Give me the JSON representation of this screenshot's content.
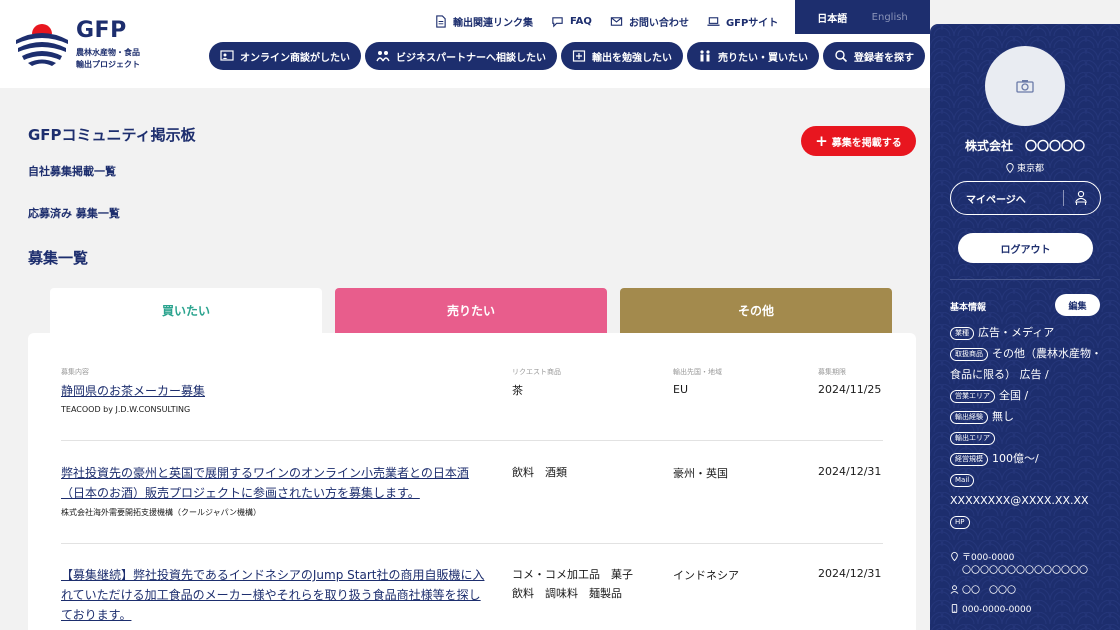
{
  "header": {
    "logo_text": "GFP",
    "logo_sub1": "農林水産物・食品",
    "logo_sub2": "輸出プロジェクト",
    "util_links": [
      {
        "label": "輸出関連リンク集",
        "icon": "document-icon"
      },
      {
        "label": "FAQ",
        "icon": "chat-icon"
      },
      {
        "label": "お問い合わせ",
        "icon": "mail-icon"
      },
      {
        "label": "GFPサイト",
        "icon": "laptop-icon"
      }
    ],
    "lang": {
      "ja": "日本語",
      "en": "English"
    },
    "nav": [
      {
        "label": "オンライン商談がしたい",
        "icon": "online-meeting-icon"
      },
      {
        "label": "ビジネスパートナーへ相談したい",
        "icon": "partner-icon"
      },
      {
        "label": "輸出を勉強したい",
        "icon": "study-icon"
      },
      {
        "label": "売りたい・買いたい",
        "icon": "trade-icon"
      },
      {
        "label": "登録者を探す",
        "icon": "search-icon"
      }
    ]
  },
  "main": {
    "title": "GFPコミュニティ掲示板",
    "post_button": "募集を掲載する",
    "link_own": "自社募集掲載一覧",
    "link_applied": "応募済み 募集一覧",
    "section_title": "募集一覧",
    "tabs": [
      "買いたい",
      "売りたい",
      "その他"
    ],
    "columns": [
      "募集内容",
      "リクエスト商品",
      "輸出先国・地域",
      "募集期限"
    ],
    "rows": [
      {
        "title": "静岡県のお茶メーカー募集",
        "org": "TEACOOD by J.D.W.CONSULTING",
        "product": "茶",
        "dest": "EU",
        "date": "2024/11/25"
      },
      {
        "title": "弊社投資先の豪州と英国で展開するワインのオンライン小売業者との日本酒（日本のお酒）販売プロジェクトに参画されたい方を募集します。",
        "org": "株式会社海外需要開拓支援機構（クールジャパン機構）",
        "product": "飲料　酒類",
        "dest": "豪州・英国",
        "date": "2024/12/31"
      },
      {
        "title": "【募集継続】弊社投資先であるインドネシアのJump Start社の商用自販機に入れていただける加工食品のメーカー様やそれらを取り扱う食品商社様等を探しております。",
        "org": "",
        "product": "コメ・コメ加工品　菓子　飲料　調味料　麺製品",
        "dest": "インドネシア",
        "date": "2024/12/31"
      }
    ]
  },
  "sidebar": {
    "company": "株式会社　〇〇〇〇〇",
    "location": "東京都",
    "mypage": "マイページへ",
    "logout": "ログアウト",
    "basic_title": "基本情報",
    "edit": "編集",
    "industry_tag": "業種",
    "industry": "広告・メディア",
    "products_tag": "取扱商品",
    "products": "その他（農林水産物・食品に限る） 広告 /",
    "area_tag": "営業エリア",
    "area": "全国 /",
    "experience_tag": "輸出経験",
    "experience": "無し",
    "export_area_tag": "輸出エリア",
    "scale_tag": "経営規模",
    "scale": "100億～/",
    "mail_tag": "Mail",
    "mail": "XXXXXXXX@XXXX.XX.XX",
    "hp_tag": "HP",
    "postal": "〒000-0000",
    "address": "〇〇〇〇〇〇〇〇〇〇〇〇〇〇",
    "person": "〇〇　〇〇〇",
    "phone": "000-0000-0000"
  },
  "colors": {
    "navy": "#1d2e6e",
    "red": "#e8161f",
    "tab_buy_text": "#2aa38e",
    "tab_sell": "#e85d8c",
    "tab_other": "#a38a4d"
  }
}
